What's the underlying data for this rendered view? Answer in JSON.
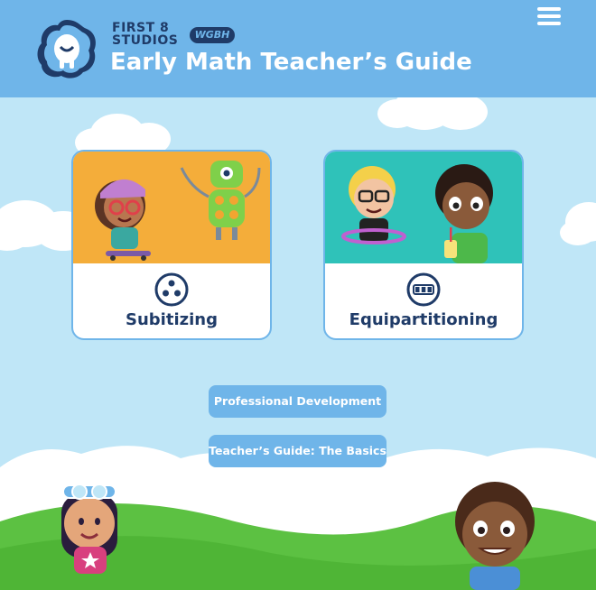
{
  "header": {
    "studio_line1": "FIRST 8",
    "studio_line2": "STUDIOS",
    "partner_logo": "WGBH",
    "app_title": "Early Math Teacher’s Guide",
    "menu_icon": "hamburger-menu-icon"
  },
  "cards": [
    {
      "label": "Subitizing",
      "icon": "three-dots-icon",
      "art_bg": "#f2a531"
    },
    {
      "label": "Equipartitioning",
      "icon": "three-squares-icon",
      "art_bg": "#2bbdb4"
    }
  ],
  "buttons": {
    "professional_development": "Professional Development",
    "teachers_guide_basics": "Teacher’s Guide: The Basics"
  },
  "colors": {
    "header_bg": "#6fb5e9",
    "sky": "#bfe6f7",
    "grass": "#5cc142",
    "navy": "#1f3b68"
  }
}
